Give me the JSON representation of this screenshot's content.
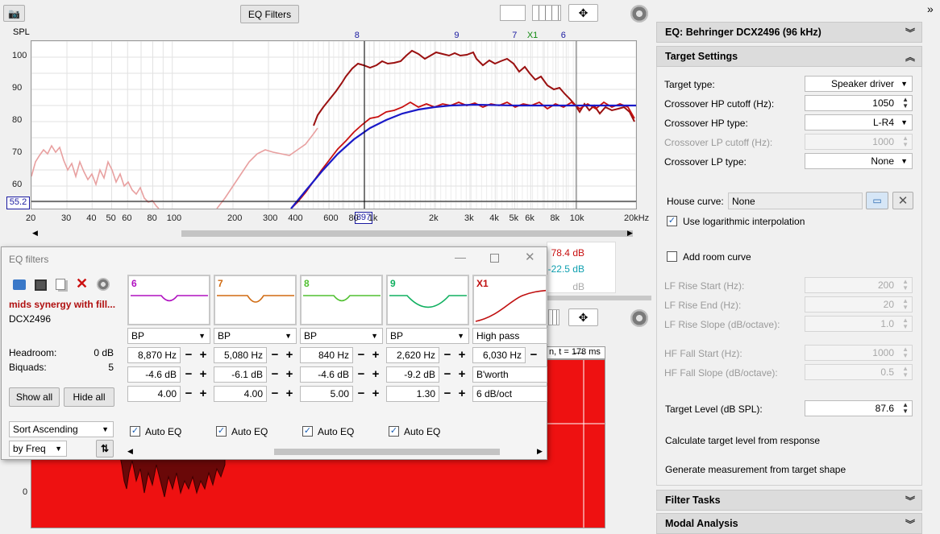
{
  "toolbar": {
    "eq_filters_label": "EQ Filters"
  },
  "spl_chart": {
    "ylabel": "SPL",
    "y_ticks": [
      "100",
      "90",
      "80",
      "70",
      "60"
    ],
    "x_ticks": [
      "20",
      "30",
      "40",
      "50",
      "60",
      "80",
      "100",
      "200",
      "300",
      "400",
      "600",
      "80",
      "1k",
      "2k",
      "3k",
      "4k",
      "5k",
      "6k",
      "8k",
      "10k",
      "20kHz"
    ],
    "cursor_x": "897",
    "cursor_y": "55.2",
    "markers": [
      {
        "label": "8",
        "color": "#1a1aa0"
      },
      {
        "label": "9",
        "color": "#1a1aa0"
      },
      {
        "label": "7",
        "color": "#1a1aa0"
      },
      {
        "label": "X1",
        "color": "#108a10"
      },
      {
        "label": "6",
        "color": "#1a1aa0"
      }
    ]
  },
  "readouts": {
    "r1": "78.4 dB",
    "r2": "-22.5 dB",
    "r3": "dB"
  },
  "lower_chart": {
    "header": "n, t = 1̶7̶8 ms",
    "y_ticks": [
      "0"
    ]
  },
  "eq_panel": {
    "title": "EQ: Behringer DCX2496 (96 kHz)"
  },
  "target_settings": {
    "title": "Target Settings",
    "rows": [
      {
        "label": "Target type:",
        "value": "Speaker driver",
        "kind": "dropdown",
        "disabled": false
      },
      {
        "label": "Crossover HP cutoff (Hz):",
        "value": "1050",
        "kind": "spin",
        "disabled": false
      },
      {
        "label": "Crossover HP type:",
        "value": "L-R4",
        "kind": "dropdown",
        "disabled": false
      },
      {
        "label": "Crossover LP cutoff (Hz):",
        "value": "1000",
        "kind": "spin",
        "disabled": true
      },
      {
        "label": "Crossover LP type:",
        "value": "None",
        "kind": "dropdown",
        "disabled": false
      }
    ],
    "house_curve_label": "House curve:",
    "house_curve_value": "None",
    "use_log_label": "Use logarithmic interpolation",
    "add_room_label": "Add room curve",
    "rows2": [
      {
        "label": "LF Rise Start (Hz):",
        "value": "200"
      },
      {
        "label": "LF Rise End (Hz):",
        "value": "20"
      },
      {
        "label": "LF Rise Slope (dB/octave):",
        "value": "1.0"
      },
      {
        "label": "HF Fall Start (Hz):",
        "value": "1000"
      },
      {
        "label": "HF Fall Slope (dB/octave):",
        "value": "0.5"
      }
    ],
    "target_level_label": "Target Level (dB SPL):",
    "target_level_value": "87.6",
    "calc_label": "Calculate target level from response",
    "generate_label": "Generate measurement from target shape"
  },
  "filter_tasks": {
    "title": "Filter Tasks"
  },
  "modal_analysis": {
    "title": "Modal Analysis"
  },
  "eq_window": {
    "title": "EQ filters",
    "preset_name": "mids synergy with fill...",
    "device": "DCX2496",
    "headroom_label": "Headroom:",
    "headroom_value": "0 dB",
    "biquads_label": "Biquads:",
    "biquads_value": "5",
    "show_all": "Show all",
    "hide_all": "Hide all",
    "sort_label": "Sort Ascending",
    "by_label": "by Freq",
    "auto_eq_label": "Auto EQ",
    "filters": [
      {
        "id": "6",
        "color": "#b010c0",
        "type": "BP",
        "freq": "8,870 Hz",
        "gain": "-4.6 dB",
        "q": "4.00"
      },
      {
        "id": "7",
        "color": "#d06a10",
        "type": "BP",
        "freq": "5,080 Hz",
        "gain": "-6.1 dB",
        "q": "4.00"
      },
      {
        "id": "8",
        "color": "#50c030",
        "type": "BP",
        "freq": "840 Hz",
        "gain": "-4.6 dB",
        "q": "5.00"
      },
      {
        "id": "9",
        "color": "#10b060",
        "type": "BP",
        "freq": "2,620 Hz",
        "gain": "-9.2 dB",
        "q": "1.30"
      },
      {
        "id": "X1",
        "color": "#c01010",
        "type": "High pass",
        "freq": "6,030 Hz",
        "gain": "B'worth",
        "q": "6 dB/oct"
      }
    ]
  }
}
